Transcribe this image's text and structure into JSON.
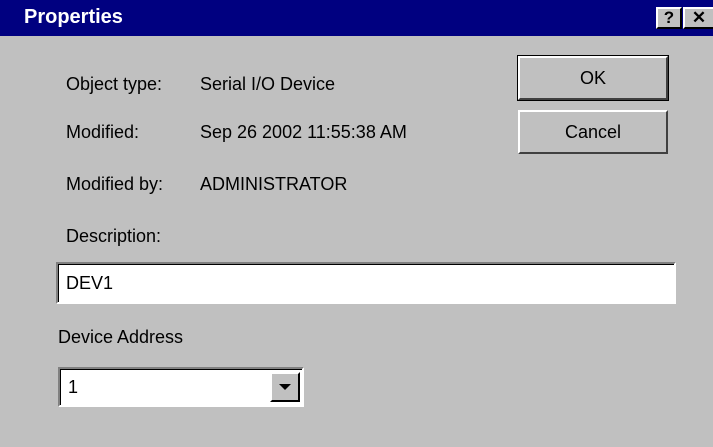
{
  "window": {
    "title": "Properties",
    "help_label": "?",
    "close_label": "✕"
  },
  "info": {
    "object_type_label": "Object type:",
    "object_type_value": "Serial I/O Device",
    "modified_label": "Modified:",
    "modified_value": "Sep 26 2002 11:55:38 AM",
    "modified_by_label": "Modified by:",
    "modified_by_value": "ADMINISTRATOR"
  },
  "buttons": {
    "ok_label": "OK",
    "cancel_label": "Cancel"
  },
  "description": {
    "label": "Description:",
    "value": "DEV1"
  },
  "device_address": {
    "label": "Device Address",
    "selected": "1"
  },
  "colors": {
    "titlebar": "#000080",
    "face": "#c0c0c0"
  }
}
